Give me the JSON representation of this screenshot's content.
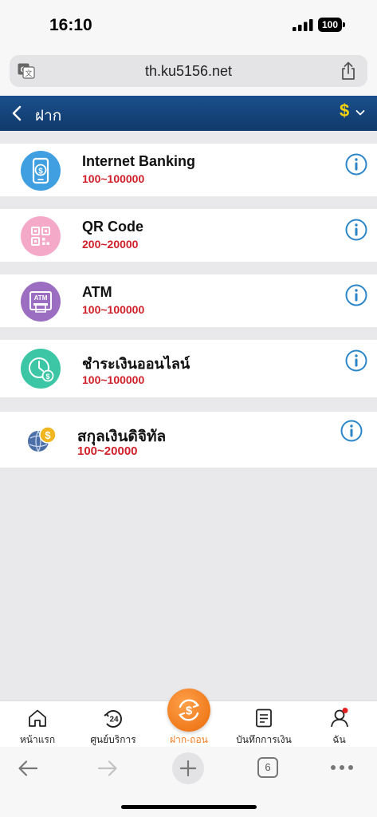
{
  "status_bar": {
    "time": "16:10",
    "battery": "100"
  },
  "browser": {
    "url": "th.ku5156.net",
    "translate_icon": "translate-icon",
    "share_icon": "share-icon",
    "tab_count": "6"
  },
  "header": {
    "title": "ฝาก",
    "currency_symbol": "$"
  },
  "methods": [
    {
      "name": "Internet Banking",
      "range": "100~100000",
      "icon": "mobile-dollar-icon",
      "color": "#3f9fe0"
    },
    {
      "name": "QR Code",
      "range": "200~20000",
      "icon": "qr-code-icon",
      "color": "#f5a9c9"
    },
    {
      "name": "ATM",
      "range": "100~100000",
      "icon": "atm-icon",
      "color": "#9b6ec2"
    },
    {
      "name": "ชำระเงินออนไลน์",
      "range": "100~100000",
      "icon": "online-payment-icon",
      "color": "#3cc6a6"
    },
    {
      "name": "สกุลเงินดิจิทัล",
      "range": "100~20000",
      "icon": "crypto-icon",
      "color": "#f0b51f"
    }
  ],
  "tabs": [
    {
      "label": "หน้าแรก",
      "icon": "home-icon"
    },
    {
      "label": "ศูนย์บริการ",
      "icon": "support-24-icon",
      "badge": "24"
    },
    {
      "label": "ฝาก-ถอน",
      "icon": "deposit-withdraw-icon",
      "active": true
    },
    {
      "label": "บันทึกการเงิน",
      "icon": "record-icon"
    },
    {
      "label": "ฉัน",
      "icon": "profile-icon"
    }
  ],
  "colors": {
    "header_bg": "#1b4f8c",
    "accent": "#f07b1d",
    "range_red": "#d0202a",
    "info_blue": "#2b86c9"
  }
}
